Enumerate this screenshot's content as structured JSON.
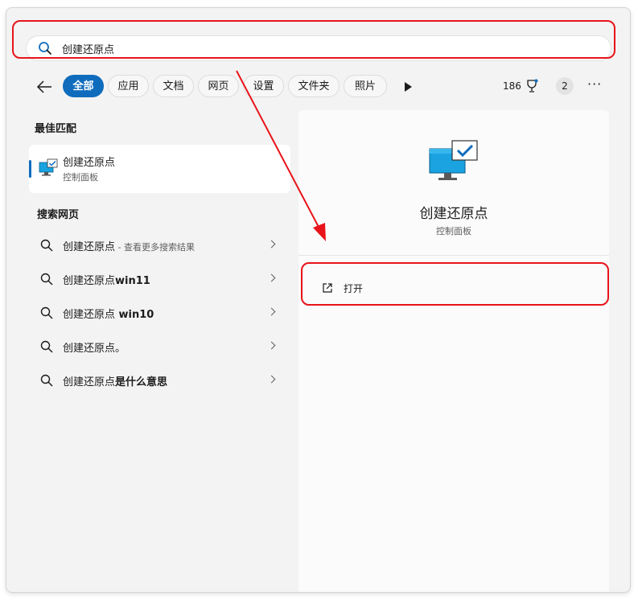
{
  "search": {
    "query": "创建还原点"
  },
  "filters": {
    "tabs": [
      {
        "label": "全部",
        "active": true
      },
      {
        "label": "应用"
      },
      {
        "label": "文档"
      },
      {
        "label": "网页"
      },
      {
        "label": "设置"
      },
      {
        "label": "文件夹"
      },
      {
        "label": "照片"
      }
    ],
    "reward_count": "186",
    "account_badge": "2"
  },
  "best_match": {
    "heading": "最佳匹配",
    "title": "创建还原点",
    "subtitle": "控制面板"
  },
  "web_search": {
    "heading": "搜索网页",
    "items": [
      {
        "main": "创建还原点",
        "bold": "",
        "hint": " - 查看更多搜索结果"
      },
      {
        "main": "创建还原点",
        "bold": "win11",
        "hint": ""
      },
      {
        "main": "创建还原点",
        "bold": " win10",
        "hint": ""
      },
      {
        "main": "创建还原点。",
        "bold": "",
        "hint": ""
      },
      {
        "main": "创建还原点",
        "bold": "是什么意思",
        "hint": ""
      }
    ]
  },
  "preview": {
    "title": "创建还原点",
    "subtitle": "控制面板",
    "open_label": "打开"
  },
  "colors": {
    "accent": "#0f6cbd",
    "annotation": "#e8141a"
  }
}
